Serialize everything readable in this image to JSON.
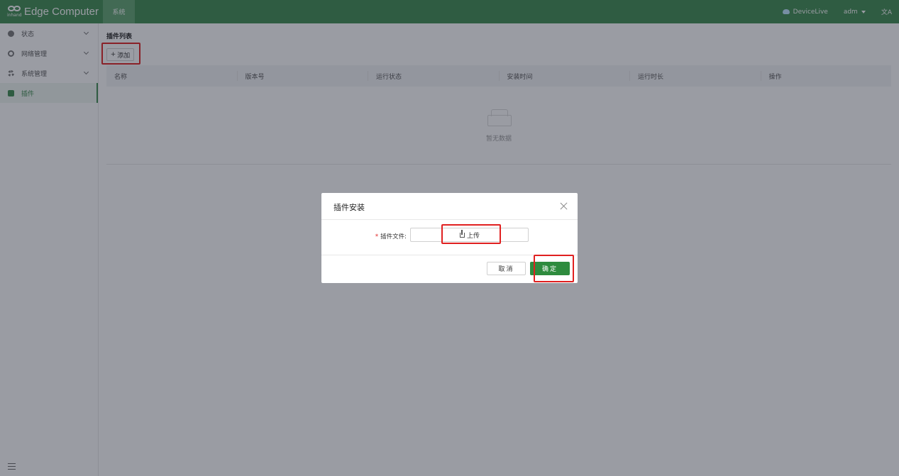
{
  "header": {
    "brand_sub": "inhand",
    "brand_name": "Edge Computer",
    "tab_label": "系统",
    "devicelive_label": "DeviceLive",
    "user_label": "adm",
    "language_glyph": "文A"
  },
  "sidebar": {
    "items": [
      {
        "label": "状态",
        "icon": "dashboard-icon"
      },
      {
        "label": "网络管理",
        "icon": "globe-icon"
      },
      {
        "label": "系统管理",
        "icon": "gear-icon"
      },
      {
        "label": "插件",
        "icon": "puzzle-icon"
      }
    ]
  },
  "main": {
    "section_title": "插件列表",
    "add_button_label": "添加",
    "table": {
      "columns": [
        "名称",
        "版本号",
        "运行状态",
        "安装时间",
        "运行时长",
        "操作"
      ],
      "rows": [],
      "empty_text": "暂无数据"
    }
  },
  "modal": {
    "title": "插件安装",
    "field_label": "插件文件:",
    "upload_label": "上传",
    "cancel_label": "取消",
    "ok_label": "确定"
  },
  "colors": {
    "brand_green": "#3d8a4f",
    "primary_button": "#2e8b3e",
    "highlight_red": "#e02020"
  }
}
